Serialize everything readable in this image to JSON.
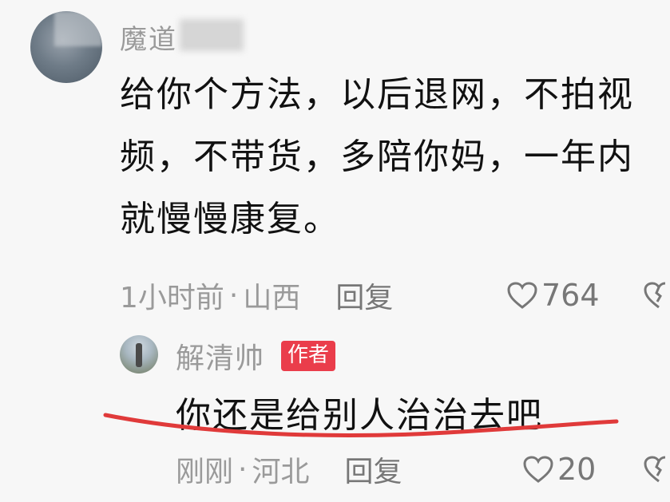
{
  "comment": {
    "username": "魔道",
    "text_lines": [
      "给你个方法，以后退网，不拍视",
      "频，不带货，多陪你妈，一年内",
      "就慢慢康复。"
    ],
    "time": "1小时前",
    "separator": "·",
    "location": "山西",
    "reply_label": "回复",
    "like_count": "764"
  },
  "reply": {
    "username": "解清帅",
    "badge": "作者",
    "text": "你还是给别人治治去吧",
    "time": "刚刚",
    "separator": "·",
    "location": "河北",
    "reply_label": "回复",
    "like_count": "20"
  },
  "colors": {
    "badge": "#ea3d4b",
    "underline": "#e03a3a",
    "meta_text": "#9a9a9a"
  }
}
